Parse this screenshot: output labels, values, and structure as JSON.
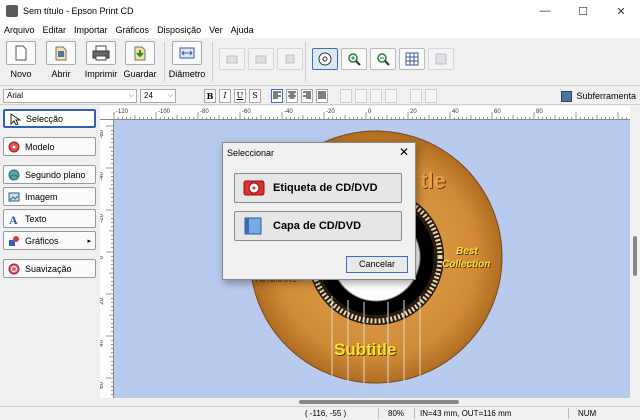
{
  "window": {
    "title": "Sem título - Epson Print CD"
  },
  "menu": [
    "Arquivo",
    "Editar",
    "Importar",
    "Gráficos",
    "Disposição",
    "Ver",
    "Ajuda"
  ],
  "toolbar": {
    "new_label": "Novo",
    "open_label": "Abrir",
    "print_label": "Imprimir",
    "save_label": "Guardar",
    "diameter_label": "Diâmetro"
  },
  "format": {
    "font_name": "Arial",
    "font_size": "24",
    "bold": "B",
    "italic": "I",
    "underline": "U",
    "shadow": "S",
    "subframe_label": "Subferramenta"
  },
  "sidebar": {
    "items": [
      {
        "label": "Selecção",
        "color": "#222222"
      },
      {
        "label": "Modelo",
        "color": "#d84040"
      },
      {
        "label": "Segundo plano",
        "color": "#3a8a50"
      },
      {
        "label": "Imagem",
        "color": "#3a6ab0"
      },
      {
        "label": "Texto",
        "color": "#3050a0"
      },
      {
        "label": "Gráficos",
        "color": "#c03030"
      },
      {
        "label": "Suavização",
        "color": "#d04050"
      }
    ]
  },
  "ruler": {
    "top": [
      "-120",
      "-100",
      "-80",
      "-60",
      "-40",
      "-20",
      "0",
      "20",
      "40",
      "60",
      "80"
    ],
    "left": [
      "-60",
      "-40",
      "-20",
      "0",
      "20",
      "40",
      "60",
      "80"
    ]
  },
  "canvas": {
    "title_partial": "tle",
    "best_collection_1": "Best",
    "best_collection_2": "Collection",
    "subtitle": "Subtitle",
    "file_name": "File name DVD"
  },
  "dialog": {
    "title": "Seleccionar",
    "close": "✕",
    "option1": "Etiqueta de CD/DVD",
    "option2": "Capa de CD/DVD",
    "cancel": "Cancelar"
  },
  "status": {
    "coords": "( -116, -55 )",
    "zoom": "80%",
    "disc_info": "IN=43 mm, OUT=116 mm",
    "num": "NUM"
  },
  "colors": {
    "canvas_bg": "#b9caef",
    "disc_wood": "#d5933c",
    "disc_dark": "#3a2a1a",
    "accent": "#3a70c0"
  }
}
